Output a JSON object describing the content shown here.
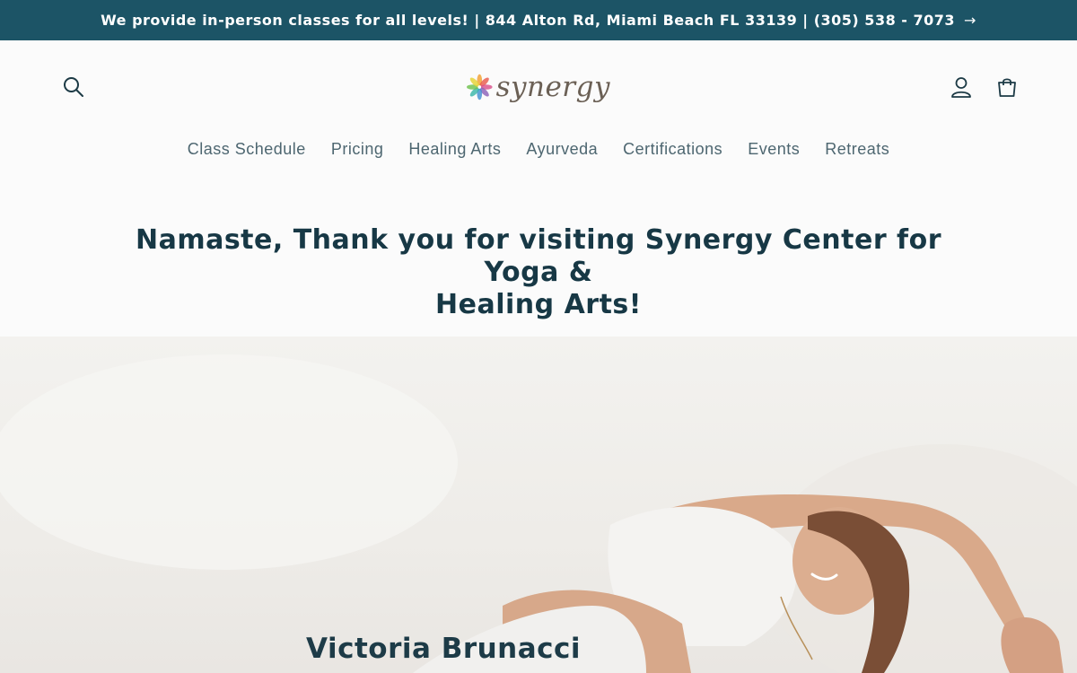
{
  "announcement": {
    "text": "We provide in-person classes for all levels! | 844 Alton Rd, Miami Beach FL 33139 | (305) 538 - 7073",
    "arrow": "→"
  },
  "header": {
    "logo_text": "synergy",
    "icons": {
      "search": "search-icon",
      "account": "user-icon",
      "cart": "cart-icon"
    }
  },
  "nav": {
    "items": [
      {
        "label": "Class Schedule"
      },
      {
        "label": "Pricing"
      },
      {
        "label": "Healing Arts"
      },
      {
        "label": "Ayurveda"
      },
      {
        "label": "Certifications"
      },
      {
        "label": "Events"
      },
      {
        "label": "Retreats"
      }
    ]
  },
  "headline": {
    "line1": "Namaste, Thank you for visiting Synergy Center for Yoga &",
    "line2": "Healing Arts!"
  },
  "hero": {
    "name": "Victoria Brunacci"
  },
  "colors": {
    "announcement_bg": "#1c5466",
    "heading": "#173845",
    "nav_text": "#4d6670"
  }
}
